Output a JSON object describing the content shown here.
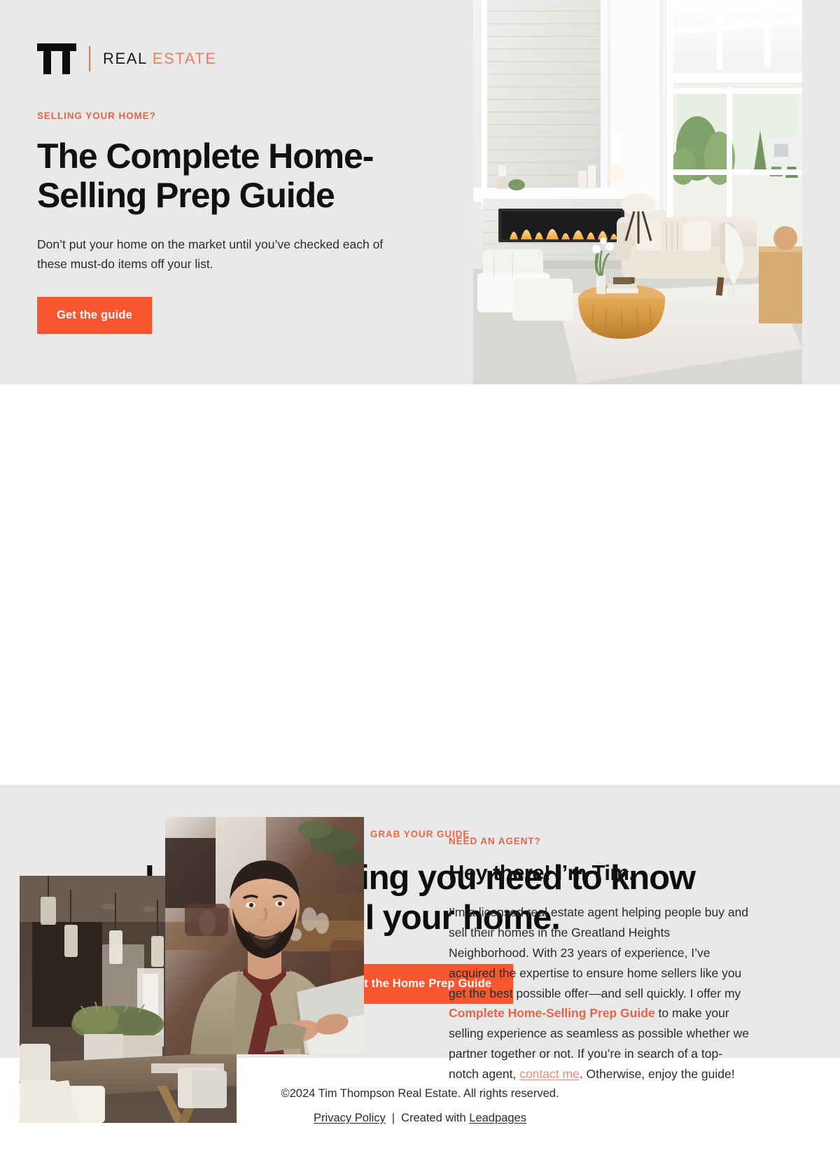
{
  "brand": {
    "logo_icon": "tt-monogram",
    "word_primary": "REAL",
    "word_accent": "ESTATE",
    "accent_color": "#f9572f",
    "eyebrow_color": "#e2664a",
    "hero_bg": "#e9e9e9"
  },
  "hero": {
    "eyebrow": "SELLING YOUR HOME?",
    "title": "The Complete Home-Selling Prep Guide",
    "subtitle": "Don’t put your home on the market until you’ve checked each of these must-do items off your list.",
    "cta_label": "Get the guide",
    "image_alt": "bright-modern-living-room-with-linear-fireplace-stone-accent-wall-beige-sofa-round-wood-coffee-table-and-tall-windows"
  },
  "about": {
    "eyebrow": "NEED AN AGENT?",
    "title": "Hey there! I’m Tim.",
    "body_part_1": "I’m a licensed real estate agent helping people buy and sell their homes in the Greatland Heights Neighborhood. With 23 years of experience,  I’ve acquired the expertise to ensure home sellers like you get the best possible offer—and sell quickly. I offer my ",
    "guide_link": "Complete Home-Selling Prep Guide",
    "body_part_2": " to make your selling experience as seamless as possible whether we partner together or not. If you’re in search of a top-notch agent, ",
    "contact_link": "contact me",
    "body_part_3": ". Otherwise, enjoy the guide!",
    "portrait_alt": "bearded-man-in-beige-blazer-and-maroon-shirt-working-on-laptop-in-restaurant",
    "interior_alt": "blurred-dining-room-with-white-upholstered-chairs-wooden-table-and-greenery-centerpiece"
  },
  "cta": {
    "eyebrow": "GRAB YOUR GUIDE",
    "title_line_1": "Learn everything you need to know",
    "title_line_2": "to sell your home.",
    "button_label": "Get the Home Prep Guide"
  },
  "footer": {
    "copyright": "©2024 Tim Thompson Real Estate. All rights reserved.",
    "privacy_label": "Privacy Policy",
    "separator": "|",
    "created_prefix": "Created with",
    "created_link": "Leadpages"
  }
}
